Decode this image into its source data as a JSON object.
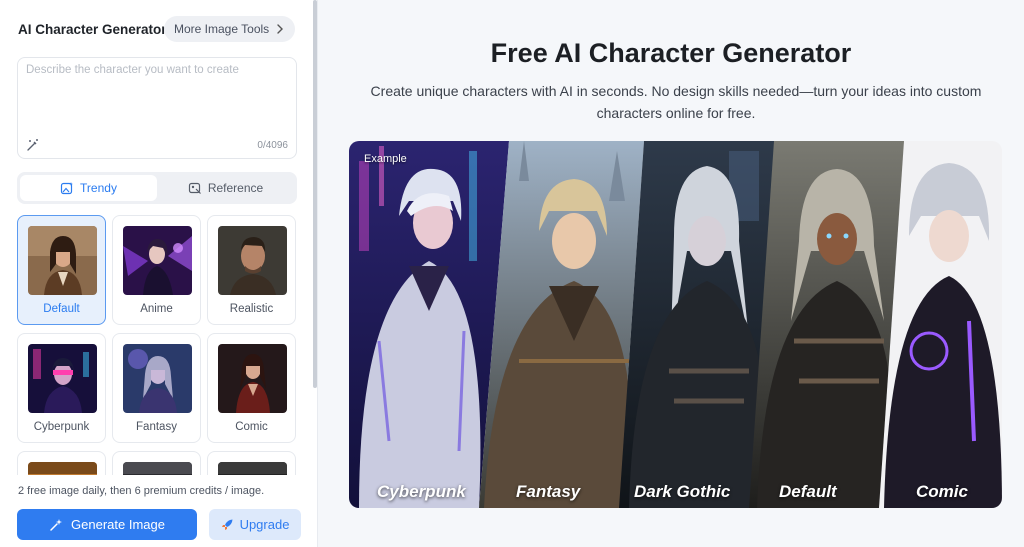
{
  "sidebar": {
    "title": "AI Character Generator",
    "more_tools_label": "More Image Tools",
    "prompt": {
      "placeholder": "Describe the character you want to create",
      "value": "",
      "counter": "0/4096"
    },
    "tabs": [
      {
        "label": "Trendy",
        "active": true
      },
      {
        "label": "Reference",
        "active": false
      }
    ],
    "styles": [
      {
        "label": "Default",
        "selected": true
      },
      {
        "label": "Anime",
        "selected": false
      },
      {
        "label": "Realistic",
        "selected": false
      },
      {
        "label": "Cyberpunk",
        "selected": false
      },
      {
        "label": "Fantasy",
        "selected": false
      },
      {
        "label": "Comic",
        "selected": false
      }
    ],
    "note": "2 free image daily, then 6 premium credits / image.",
    "generate_label": "Generate Image",
    "upgrade_label": "Upgrade"
  },
  "main": {
    "title": "Free AI Character Generator",
    "subtitle": "Create unique characters with AI in seconds. No design skills needed—turn your ideas into custom characters online for free.",
    "example_label": "Example",
    "panels": [
      {
        "label": "Cyberpunk"
      },
      {
        "label": "Fantasy"
      },
      {
        "label": "Dark Gothic"
      },
      {
        "label": "Default"
      },
      {
        "label": "Comic"
      }
    ]
  },
  "colors": {
    "accent": "#2f7cf0",
    "accent_light": "#dde9fb",
    "selected_bg": "#e7f0fc"
  }
}
